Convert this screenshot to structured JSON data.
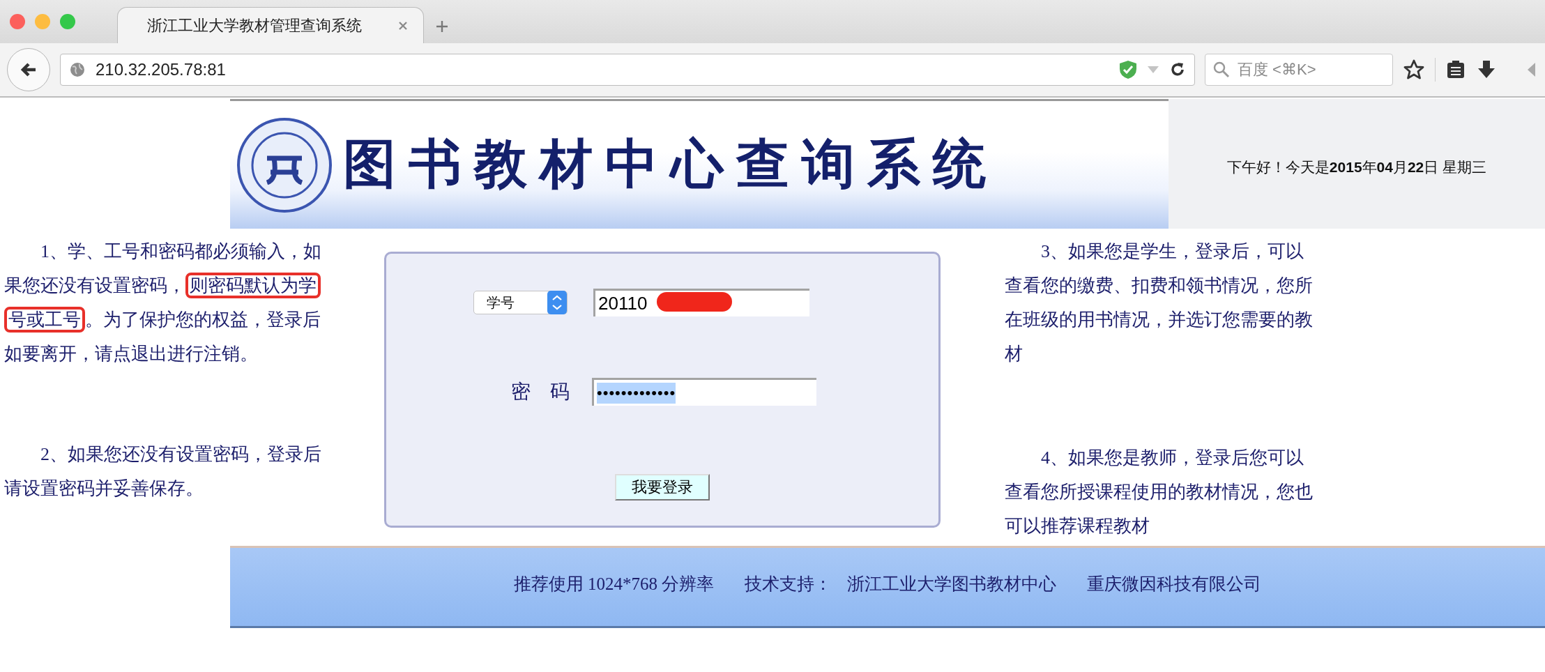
{
  "browser": {
    "tabs": [
      {
        "title": "浙江工业大学教材管理查询系统",
        "selected": true
      }
    ],
    "address": "210.32.205.78:81",
    "search": {
      "placeholder": "百度 <⌘K>"
    }
  },
  "header": {
    "title": "图书教材中心查询系统",
    "greeting": "下午好！今天是**2015**年**04**月**22**日 星期三"
  },
  "notices_left": [
    {
      "segments": [
        {
          "text": "1、学、工号和密码都必须输入，如果您还没有设置密码，",
          "annotated": false
        },
        {
          "text": "则密码默认为学号或工号",
          "annotated": true
        },
        {
          "text": "。为了保护您的权益，登录后如要离开，请点退出进行注销。",
          "annotated": false
        }
      ]
    },
    {
      "segments": [
        {
          "text": "2、如果您还没有设置密码，登录后请设置密码并妥善保存。",
          "annotated": false
        }
      ]
    }
  ],
  "login": {
    "id_type": {
      "value": "学号"
    },
    "id_field": {
      "value": "20110",
      "redacted": true
    },
    "password_label": "密　码",
    "password_field": {
      "value": "•••••••••••••",
      "selected": true
    },
    "submit": "我要登录"
  },
  "notices_right": [
    {
      "segments": [
        {
          "text": "3、如果您是学生，登录后，可以查看您的缴费、扣费和领书情况，您所在班级的用书情况，并选订您需要的教材",
          "annotated": false
        }
      ]
    },
    {
      "segments": [
        {
          "text": "4、如果您是教师，登录后您可以查看您所授课程使用的教材情况，您也可以推荐课程教材",
          "annotated": false
        }
      ]
    }
  ],
  "footer": [
    "推荐使用 1024*768 分辨率",
    "技术支持：",
    "浙江工业大学图书教材中心",
    "重庆微因科技有限公司"
  ]
}
